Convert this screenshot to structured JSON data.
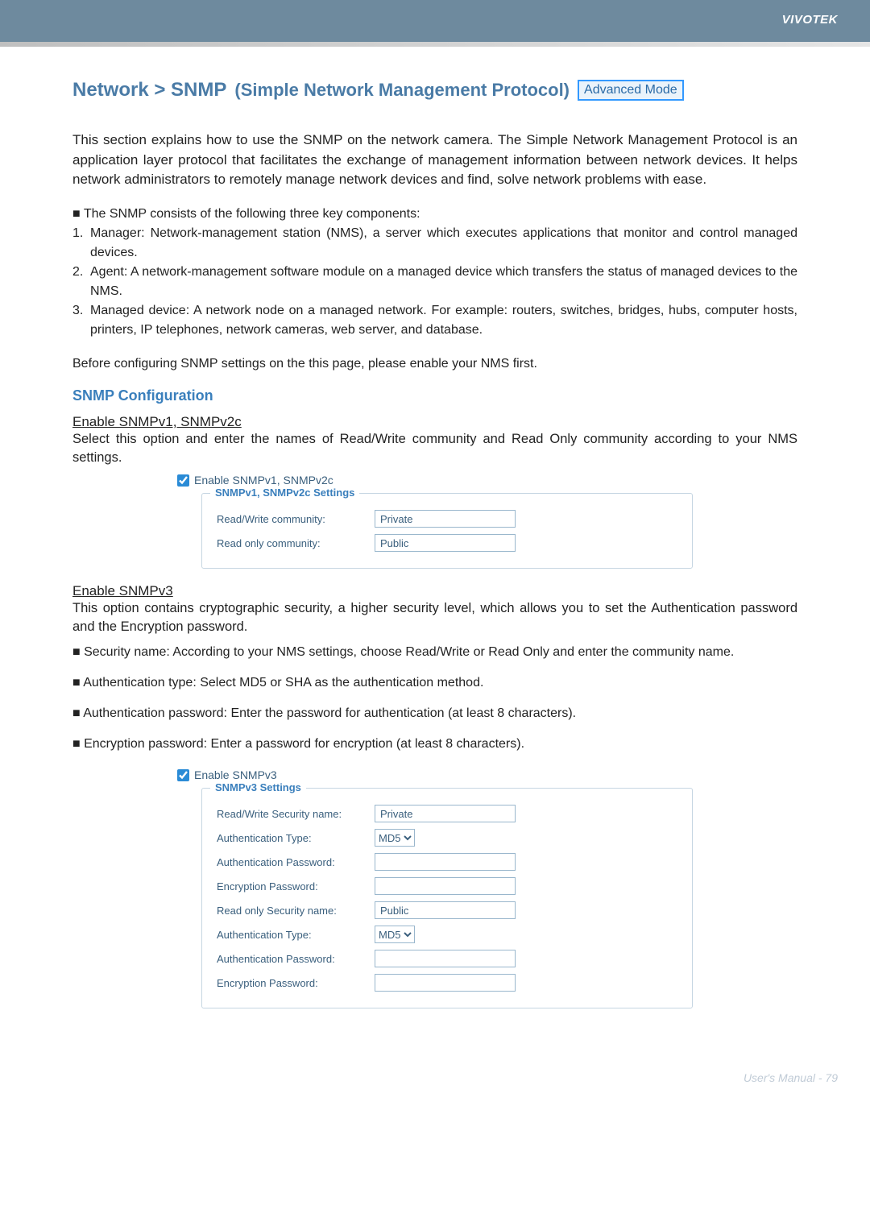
{
  "brand": "VIVOTEK",
  "title": {
    "main": "Network > SNMP",
    "sub": "(Simple Network Management Protocol)",
    "badge": "Advanced Mode"
  },
  "intro": "This section explains how to use the SNMP on the network camera. The Simple Network Management Protocol is an application layer protocol that facilitates the exchange of management information between network devices. It helps network administrators to remotely manage network devices and find, solve network problems with ease.",
  "components_intro": "■ The SNMP consists of the following three key components:",
  "components": [
    {
      "mk": "1.",
      "tx": "Manager: Network-management station (NMS), a server which executes applications that monitor and control managed devices."
    },
    {
      "mk": "2.",
      "tx": "Agent: A network-management software module on a managed device which transfers the status of managed devices to the NMS."
    },
    {
      "mk": "3.",
      "tx": "Managed device: A network node on a managed network. For example: routers, switches, bridges, hubs, computer hosts, printers, IP telephones, network cameras, web server, and database."
    }
  ],
  "before_note": "Before configuring SNMP settings on the this page, please enable your NMS first.",
  "section_head": "SNMP Configuration",
  "v1v2c": {
    "link": "Enable SNMPv1, SNMPv2c",
    "desc": "Select this option and enter the names of Read/Write community and Read Only community according to your NMS settings.",
    "chk_label": "Enable SNMPv1, SNMPv2c",
    "legend": "SNMPv1, SNMPv2c Settings",
    "rw_label": "Read/Write community:",
    "rw_value": "Private",
    "ro_label": "Read only community:",
    "ro_value": "Public"
  },
  "v3": {
    "link": "Enable SNMPv3",
    "desc": "This option contains cryptographic security, a higher security level, which allows you to set the Authentication password and the Encryption password.",
    "bullets": [
      "■ Security name: According to your NMS settings, choose Read/Write or Read Only and enter the community name.",
      "■ Authentication type: Select MD5 or SHA as the authentication method.",
      "■ Authentication password: Enter the password for authentication (at least 8 characters).",
      "■ Encryption password: Enter a password for encryption (at least 8 characters)."
    ],
    "chk_label": "Enable SNMPv3",
    "legend": "SNMPv3 Settings",
    "rw_sec_label": "Read/Write Security name:",
    "rw_sec_value": "Private",
    "auth_type_label": "Authentication Type:",
    "auth_type_value": "MD5",
    "auth_pw_label": "Authentication Password:",
    "enc_pw_label": "Encryption Password:",
    "ro_sec_label": "Read only Security name:",
    "ro_sec_value": "Public"
  },
  "footer": "User's Manual - 79"
}
